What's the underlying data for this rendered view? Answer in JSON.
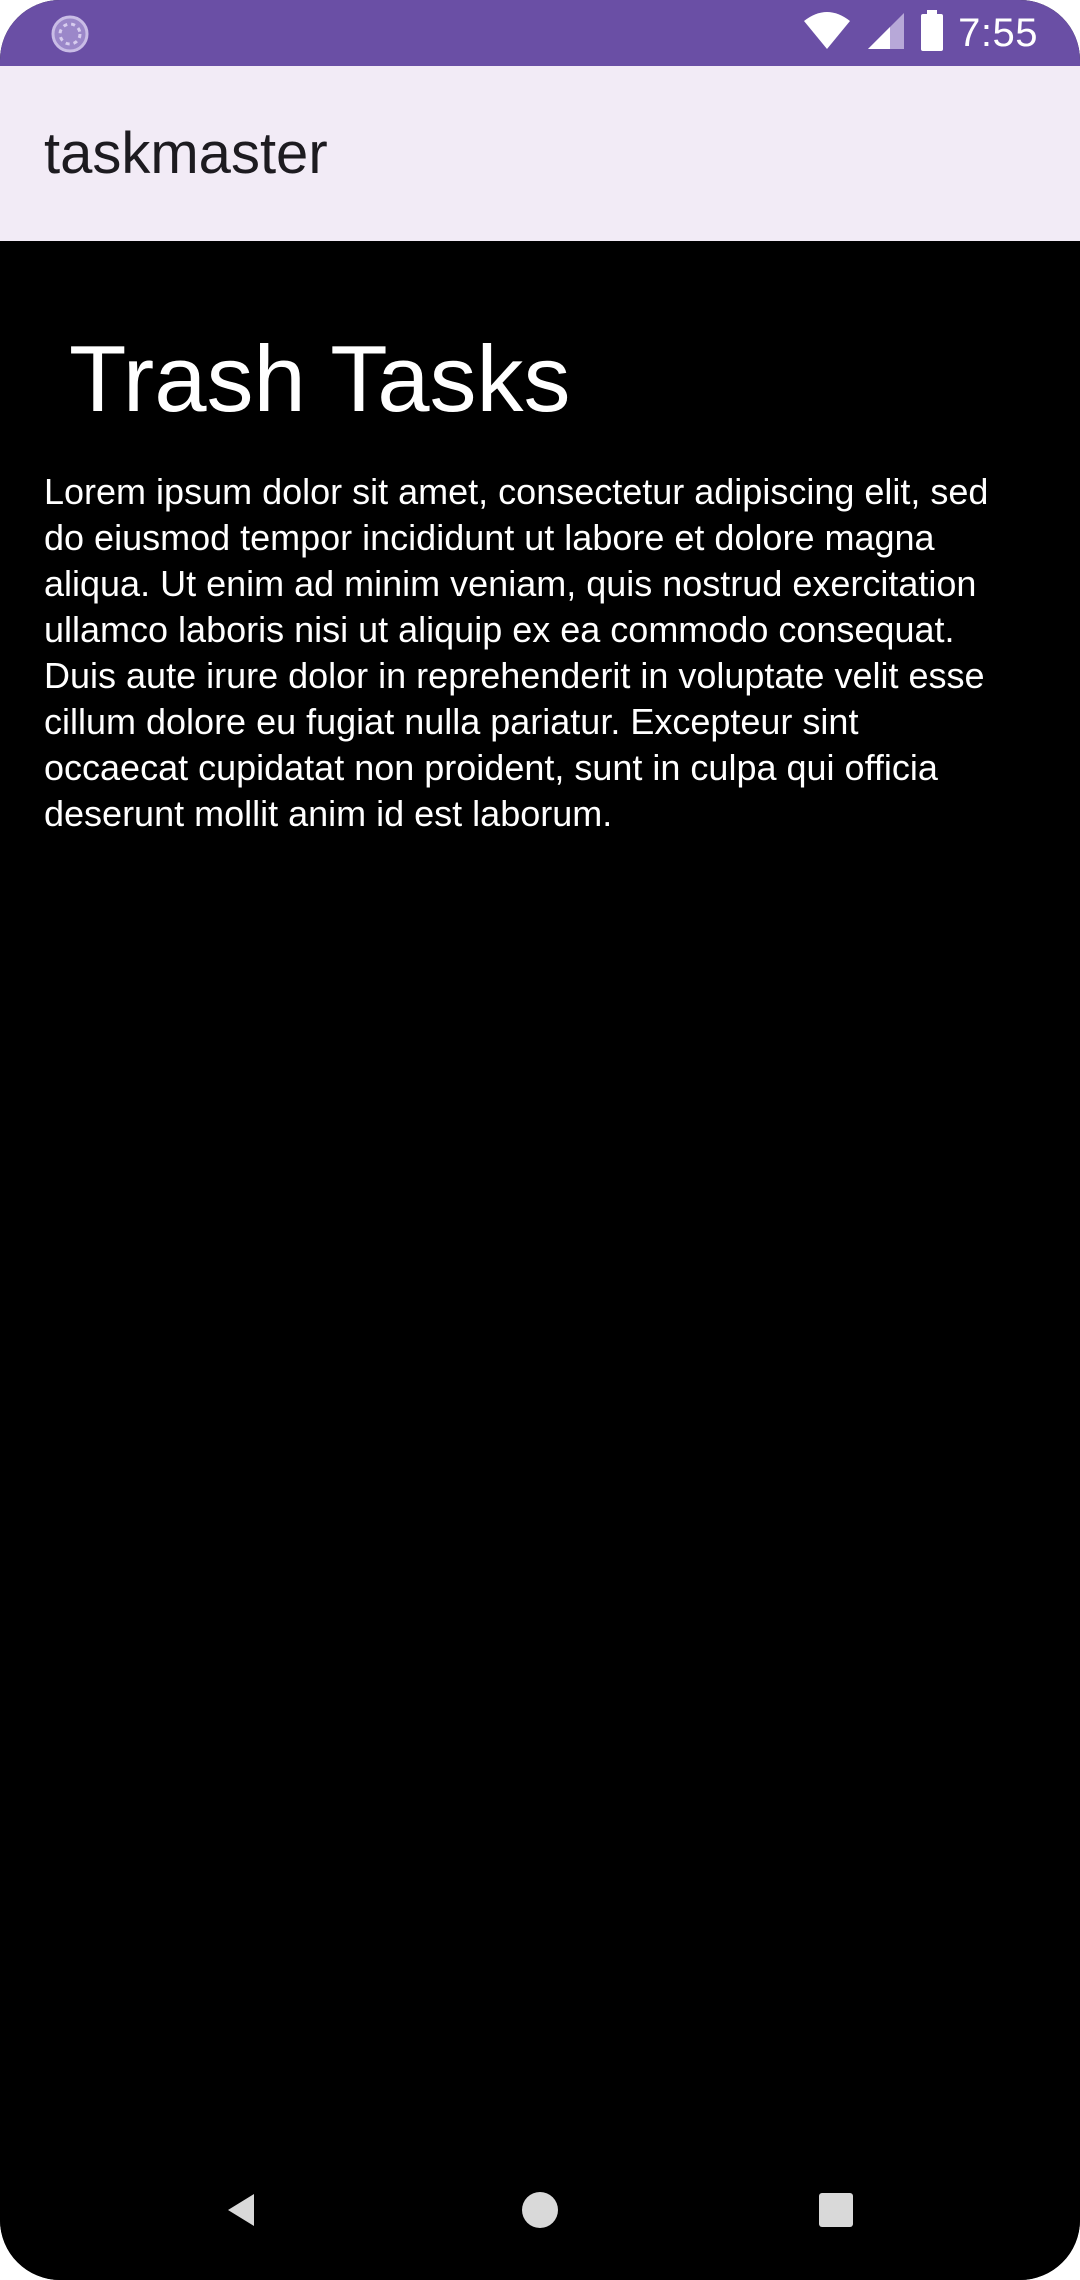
{
  "status_bar": {
    "time": "7:55",
    "color": "#6a4fa5",
    "icons": [
      "loading-indicator-icon",
      "wifi-icon",
      "cellular-signal-icon",
      "battery-icon"
    ]
  },
  "app_bar": {
    "title": "taskmaster",
    "background": "#f2ebf6"
  },
  "main": {
    "title": "Trash Tasks",
    "body": "Lorem ipsum dolor sit amet, consectetur adipiscing elit, sed do eiusmod tempor incididunt ut labore et dolore magna aliqua. Ut enim ad minim veniam, quis nostrud exercitation ullamco laboris nisi ut aliquip ex ea commodo consequat. Duis aute irure dolor in reprehenderit in voluptate velit esse cillum dolore eu fugiat nulla pariatur. Excepteur sint occaecat cupidatat non proident, sunt in culpa qui officia deserunt mollit anim id est laborum.",
    "background": "#000000"
  },
  "nav_bar": {
    "buttons": [
      "back-icon",
      "home-icon",
      "recents-icon"
    ]
  }
}
